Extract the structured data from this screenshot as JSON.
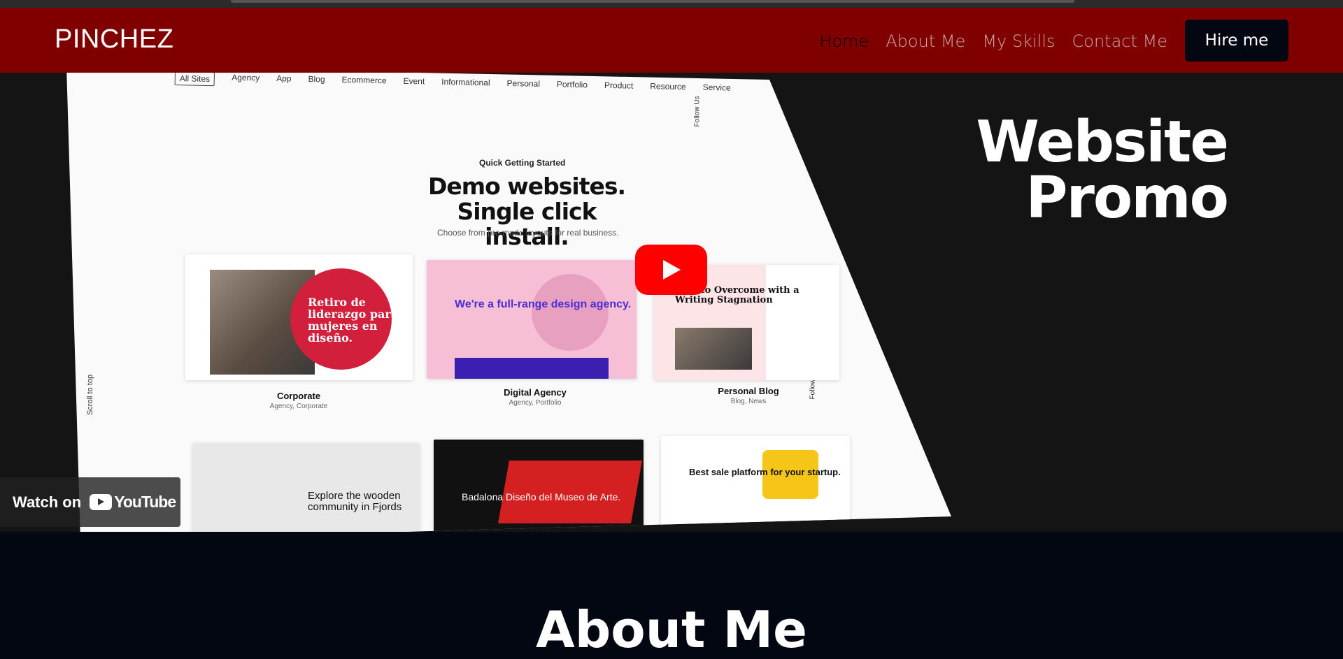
{
  "navbar": {
    "brand": "PINCHEZ",
    "links": [
      "Home",
      "About Me",
      "My Skills",
      "Contact Me"
    ],
    "active_link": "Home",
    "cta_label": "Hire me",
    "bg_color": "#800000"
  },
  "video": {
    "filters": [
      "All Sites",
      "Agency",
      "App",
      "Blog",
      "Ecommerce",
      "Event",
      "Informational",
      "Personal",
      "Portfolio",
      "Product",
      "Resource",
      "Service"
    ],
    "scroll_label": "Scroll to top",
    "follow_label": "Follow Us",
    "hero_kicker": "Quick Getting Started",
    "hero_title": "Demo websites. Single click install.",
    "hero_subtitle": "Choose from pre-made layouts for real business.",
    "cards": [
      {
        "label": "Corporate",
        "tags": "Agency, Corporate",
        "text": "Retiro de liderazgo para mujeres en diseño."
      },
      {
        "label": "Digital Agency",
        "tags": "Agency, Portfolio",
        "text": "We're a full-range design agency."
      },
      {
        "label": "Personal Blog",
        "tags": "Blog, News",
        "text": "How to Overcome with a Writing Stagnation"
      },
      {
        "label": "",
        "tags": "",
        "text": "Explore the wooden community in Fjords"
      },
      {
        "label": "",
        "tags": "",
        "text": "Badalona Diseño del Museo de Arte."
      },
      {
        "label": "",
        "tags": "",
        "text": "Best sale platform for your startup."
      }
    ],
    "promo_line1": "Website",
    "promo_line2": "Promo",
    "watch_on": "Watch on",
    "youtube_word": "YouTube",
    "play_color": "#ff0000"
  },
  "about": {
    "heading": "About Me"
  }
}
